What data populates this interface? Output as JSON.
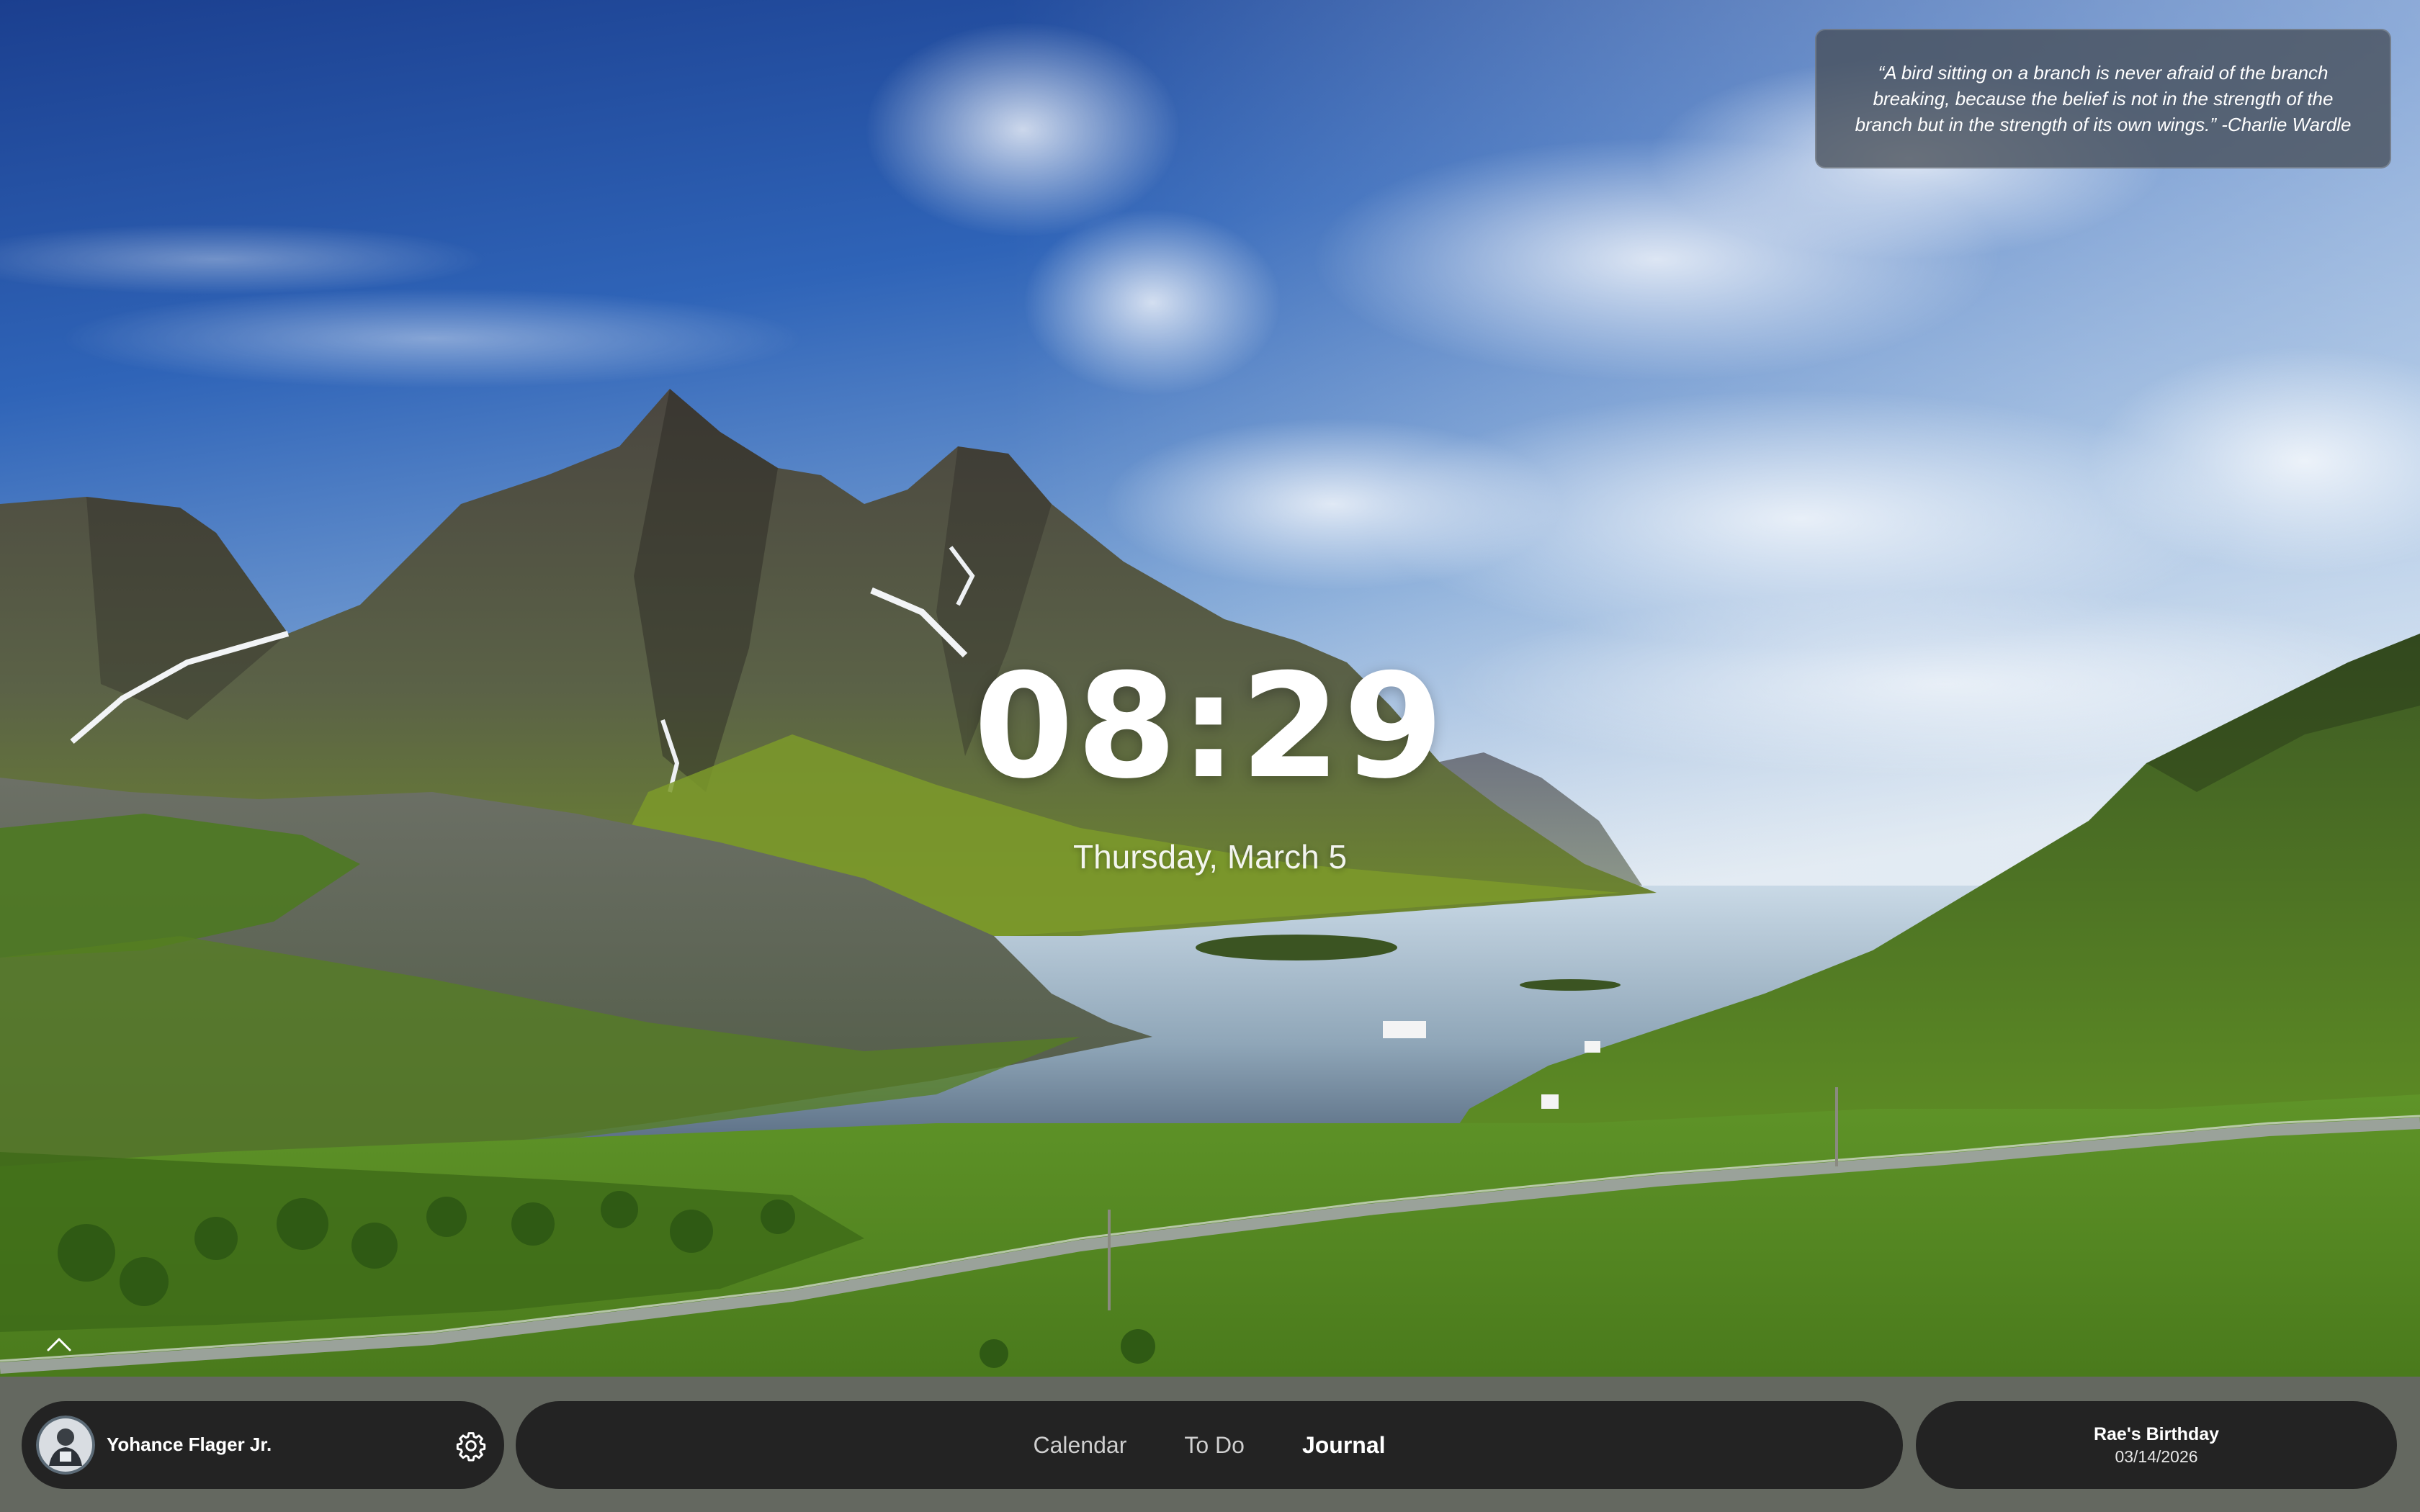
{
  "quote": {
    "text": "“A bird sitting on a branch is never afraid of the branch breaking, because the belief is not in the strength of the branch but in the strength of its own wings.” -Charlie Wardle"
  },
  "clock": {
    "time": "08:29",
    "date": "Thursday, March 5"
  },
  "profile": {
    "name": "Yohance Flager Jr.",
    "settings_icon": "gear-icon"
  },
  "nav": {
    "items": [
      {
        "label": "Calendar",
        "active": false
      },
      {
        "label": "To Do",
        "active": false
      },
      {
        "label": "Journal",
        "active": true
      }
    ]
  },
  "event": {
    "title": "Rae's Birthday",
    "date": "03/14/2026"
  },
  "colors": {
    "dock_pill": "#232323",
    "text_primary": "#ffffff",
    "nav_inactive": "#cfcfcf"
  }
}
